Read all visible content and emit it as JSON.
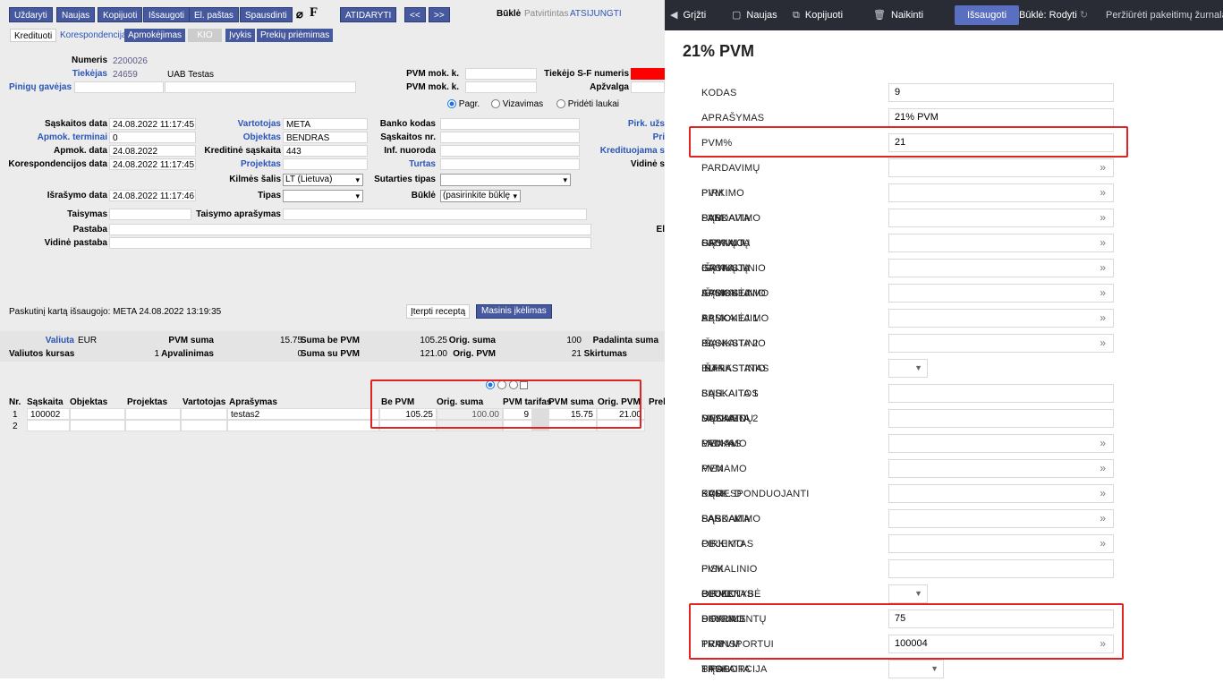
{
  "toolbar": {
    "uzdaryti": "Uždaryti",
    "naujas": "Naujas",
    "kopijuoti": "Kopijuoti",
    "issaugoti": "Išsaugoti",
    "el_pastas": "El. paštas",
    "spausdinti": "Spausdinti",
    "f_label": "F",
    "atidaryti": "ATIDARYTI",
    "prev": "<<",
    "next": ">>",
    "bukle_label": "Būklė",
    "bukle_value": "Patvirtintas",
    "atsijungti": "ATSIJUNGTI"
  },
  "tabs": {
    "kreditiuoti": "Kredituoti",
    "korespondencija": "Korespondencija",
    "apmokejimas": "Apmokėjimas",
    "kio": "KIO",
    "ivykis": "Įvykis",
    "prekiu": "Prekių priėmimas"
  },
  "header": {
    "numeris_l": "Numeris",
    "numeris_v": "2200026",
    "tiekejas_l": "Tiekėjas",
    "tiekejas_v": "24659",
    "tiekejas_name": "UAB Testas",
    "pvmmok_l": "PVM mok. k.",
    "tsf_l": "Tiekėjo S-F numeris",
    "pinigu_l": "Pinigų gavėjas",
    "pvmmok2_l": "PVM mok. k.",
    "apzvalga_l": "Apžvalga",
    "radio_pagr": "Pagr.",
    "radio_viza": "Vizavimas",
    "radio_prideti": "Pridėti laukai"
  },
  "form": {
    "sask_data_l": "Sąskaitos data",
    "sask_data_v": "24.08.2022 11:17:45",
    "vartotojas_l": "Vartotojas",
    "vartotojas_v": "META",
    "banko_l": "Banko kodas",
    "pirk_l": "Pirk. užs",
    "apmok_term_l": "Apmok. terminai",
    "apmok_term_v": "0",
    "objektas_l": "Objektas",
    "objektas_v": "BENDRAS",
    "saskaitos_nr_l": "Sąskaitos nr.",
    "pri_l": "Pri",
    "apmok_data_l": "Apmok. data",
    "apmok_data_v": "24.08.2022",
    "kreditine_l": "Kreditinė sąskaita",
    "kreditine_v": "443",
    "inf_l": "Inf. nuoroda",
    "kredituojama_l": "Kredituojama s",
    "koresp_data_l": "Korespondencijos data",
    "koresp_data_v": "24.08.2022 11:17:45",
    "projektas_l": "Projektas",
    "turtas_l": "Turtas",
    "vidine_l": "Vidinė s",
    "kilmes_l": "Kilmės šalis",
    "kilmes_v": "LT (Lietuva)",
    "sutarties_l": "Sutarties tipas",
    "israsymo_l": "Išrašymo data",
    "israsymo_v": "24.08.2022 11:17:46",
    "tipas_l": "Tipas",
    "bukle_l": "Būklė",
    "bukle_v": "(pasirinkite būklę",
    "taisymas_l": "Taisymas",
    "taisymo_apr_l": "Taisymo aprašymas",
    "pastaba_l": "Pastaba",
    "el_l": "El",
    "vidine_pastaba_l": "Vidinė pastaba"
  },
  "last_saved": "Paskutinį kartą išsaugojo: META 24.08.2022 13:19:35",
  "iterpti": "Įterpti receptą",
  "masinis": "Masinis įkėlimas",
  "totals": {
    "valiuta_l": "Valiuta",
    "valiuta_v": "EUR",
    "pvm_suma_l": "PVM suma",
    "pvm_suma_v": "15.75",
    "suma_be_l": "Suma be PVM",
    "suma_be_v": "105.25",
    "orig_suma_l": "Orig. suma",
    "orig_suma_v": "100",
    "padalinta_l": "Padalinta suma",
    "kursas_l": "Valiutos kursas",
    "kursas_v": "1",
    "apval_l": "Apvalinimas",
    "apval_v": "0",
    "suma_su_l": "Suma su PVM",
    "suma_su_v": "121.00",
    "orig_pvm_l": "Orig. PVM",
    "orig_pvm_v": "21",
    "skirtumas_l": "Skirtumas"
  },
  "grid": {
    "headers": {
      "nr": "Nr.",
      "saskaita": "Sąskaita",
      "objektas": "Objektas",
      "projektas": "Projektas",
      "vartotojas": "Vartotojas",
      "aprasymas": "Aprašymas",
      "be_pvm": "Be PVM",
      "orig_suma": "Orig. suma",
      "pvm_tarifas": "PVM tarifas",
      "pvm_suma": "PVM suma",
      "orig_pvm": "Orig. PVM",
      "prek": "Prek"
    },
    "row1": {
      "nr": "1",
      "saskaita": "100002",
      "aprasymas": "testas2",
      "be_pvm": "105.25",
      "orig_suma": "100.00",
      "pvm_tarifas": "9",
      "pvm_suma": "15.75",
      "orig_pvm": "21.00"
    },
    "row2": {
      "nr": "2"
    }
  },
  "right_toolbar": {
    "grizti": "Grįžti",
    "naujas": "Naujas",
    "kopijuoti": "Kopijuoti",
    "naikinti": "Naikinti",
    "issaugoti": "Išsaugoti",
    "bukle": "Būklė: Rodyti",
    "zurnalas": "Peržiūrėti pakeitimų žurnalą"
  },
  "panel_title": "21% PVM",
  "fields": {
    "kodas_l": "KODAS",
    "kodas_v": "9",
    "aprasymas_l": "APRAŠYMAS",
    "aprasymas_v": "21% PVM",
    "pvm_l": "PVM%",
    "pvm_v": "21",
    "pardavimu_pvm_l": "PARDAVIMŲ PVM SĄSKAITA",
    "pirkimo_pvm_l": "PIRKIMO PVM SĄSKAITA",
    "pard_gryn_l": "PARDAVIMO GRYNŲJŲ SĄSKAITA",
    "pirk_gryn_l": "PIRKIMO GRYNŲJŲ SĄSKAITA",
    "isank1_l": "IŠANKSTINIO APMOKĖJIMO SĄSKAITA 1",
    "isank2_l": "IŠANKSTINIO APMOKĖJIMO SĄSKAITA 2",
    "pl1_l": "PL IŠANKSTINIO BUH. SĄSKAITA 1",
    "pl2_l": "PL IŠANKSTINIO BUH. SĄSKAITA 2",
    "intrastatas_l": "INTRASTATAS",
    "duomenu_l": "SĄSKAITOS DUOMENŲ LAUKAS",
    "menamo_pvm_l": "MENAMO PVM %",
    "menamo_d_l": "MENAMO PVM SĄSK. D",
    "menamo_k_l": "MENAMO PVM SĄSK. K",
    "koresp_l": "KORESPONDUOJANTI SĄSKAITA",
    "pard_obj_l": "PARDAVIMO OBJEKTAS",
    "pirk_obj_l": "PIRKIMO PVM OBJEKTAS",
    "fiskal_l": "FISKALINIO BLOKO SKYRIUS",
    "pirmenybe_l": "PIRMENYBĖ DOKUMENTŲ TRANSPORTUI",
    "proporcija_l": "PIRKIMO PVM PROPORCIJA",
    "proporcija_v": "75",
    "pr_pvm_l": "PR PVM SĄSKAITA",
    "pr_pvm_v": "100004",
    "tipas_l": "TIPAS",
    "arrow": "»"
  },
  "colors": {
    "accent": "#46599e",
    "highlight": "#e02424",
    "topbar": "#2a2c35"
  }
}
